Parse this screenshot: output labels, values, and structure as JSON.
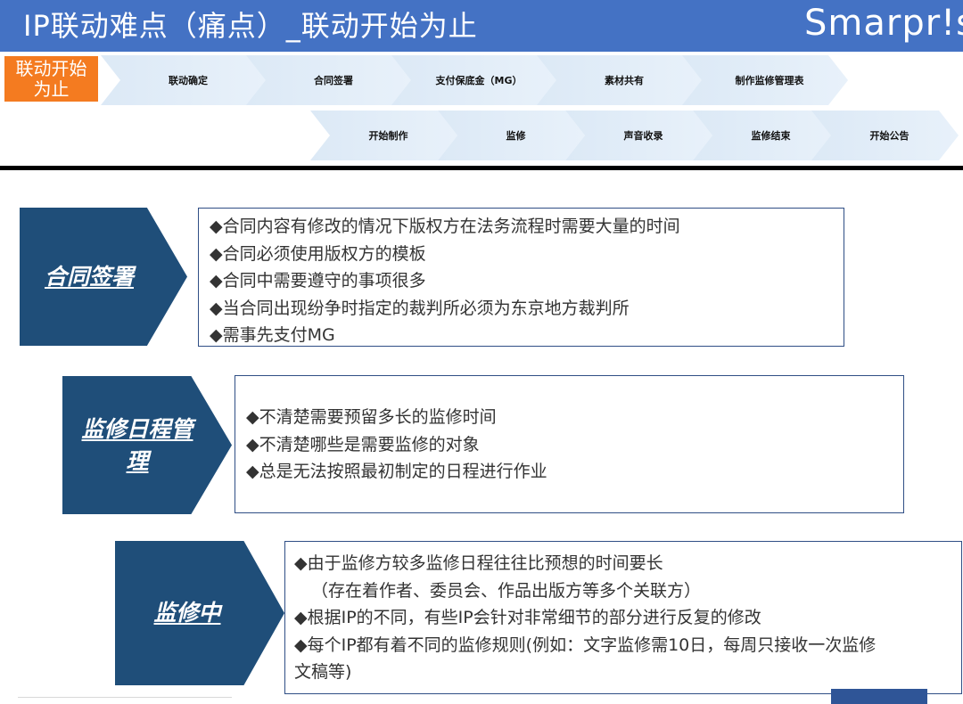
{
  "header": {
    "title": "IP联动难点（痛点）_联动开始为止",
    "logo": "Smarpr!se"
  },
  "flow": {
    "start_label": [
      "联动开始",
      "为止"
    ],
    "row1": [
      "联动确定",
      "合同签署",
      "支付保底金（MG）",
      "素材共有",
      "制作监修管理表"
    ],
    "row2": [
      "开始制作",
      "监修",
      "声音收录",
      "监修结束",
      "开始公告"
    ]
  },
  "sections": [
    {
      "label": "合同签署",
      "points": [
        "◆合同内容有修改的情况下版权方在法务流程时需要大量的时间",
        "◆合同必须使用版权方的模板",
        "◆合同中需要遵守的事项很多",
        "◆当合同出现纷争时指定的裁判所必须为东京地方裁判所",
        "◆需事先支付MG"
      ]
    },
    {
      "label": [
        "监修日程管",
        "理"
      ],
      "points": [
        "◆不清楚需要预留多长的监修时间",
        "◆不清楚哪些是需要监修的对象",
        "◆总是无法按照最初制定的日程进行作业"
      ]
    },
    {
      "label": "监修中",
      "points": [
        "◆由于监修方较多监修日程往往比预想的时间要长",
        "（存在着作者、委员会、作品出版方等多个关联方）",
        "◆根据IP的不同，有些IP会针对非常细节的部分进行反复的修改",
        "◆每个IP都有着不同的监修规则(例如：文字监修需10日，每周只接收一次监修",
        "文稿等)"
      ]
    }
  ],
  "colors": {
    "header_bg": "#4472c4",
    "start_label_bg": "#f47b20",
    "chevron_bg": "#1f4e79",
    "box_border": "#2f4e85"
  }
}
